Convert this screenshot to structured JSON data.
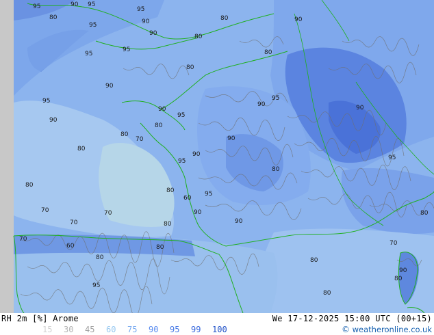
{
  "map": {
    "contour_labels": [
      "95",
      "90",
      "95",
      "80",
      "95",
      "90",
      "95",
      "80",
      "90",
      "95",
      "80",
      "90",
      "80",
      "95",
      "90",
      "95",
      "90",
      "80",
      "90",
      "95",
      "80",
      "90",
      "95",
      "80",
      "90",
      "80",
      "95",
      "80",
      "70",
      "80",
      "90",
      "95",
      "80",
      "70",
      "60",
      "80",
      "90",
      "70",
      "80",
      "95",
      "90",
      "70",
      "80",
      "60",
      "80",
      "70",
      "90",
      "80",
      "70",
      "80",
      "90",
      "95",
      "80"
    ],
    "legend_colors": [
      "#d2d2d2",
      "#c8dcf0",
      "#b4d2f0",
      "#a0c8f0",
      "#8cb4f0",
      "#78a0e6",
      "#648cdc",
      "#5078d2",
      "#3c64c8"
    ],
    "coastline_color": "#1fb01f",
    "contour_color": "#6e6e6e"
  },
  "footer": {
    "title": "RH 2m [%] Arome",
    "valid_time": "We 17-12-2025 15:00 UTC (00+15)",
    "credit_symbol": "©",
    "credit_text": " weatheronline.co.uk",
    "legend": [
      {
        "label": "15",
        "color": "#d2d2d2"
      },
      {
        "label": "30",
        "color": "#b4b4b4"
      },
      {
        "label": "45",
        "color": "#a0a0a0"
      },
      {
        "label": "60",
        "color": "#96c8f0"
      },
      {
        "label": "75",
        "color": "#78aaf0"
      },
      {
        "label": "90",
        "color": "#5a8cf0"
      },
      {
        "label": "95",
        "color": "#4678e6"
      },
      {
        "label": "99",
        "color": "#3264dc"
      },
      {
        "label": "100",
        "color": "#1e50c8"
      }
    ]
  }
}
